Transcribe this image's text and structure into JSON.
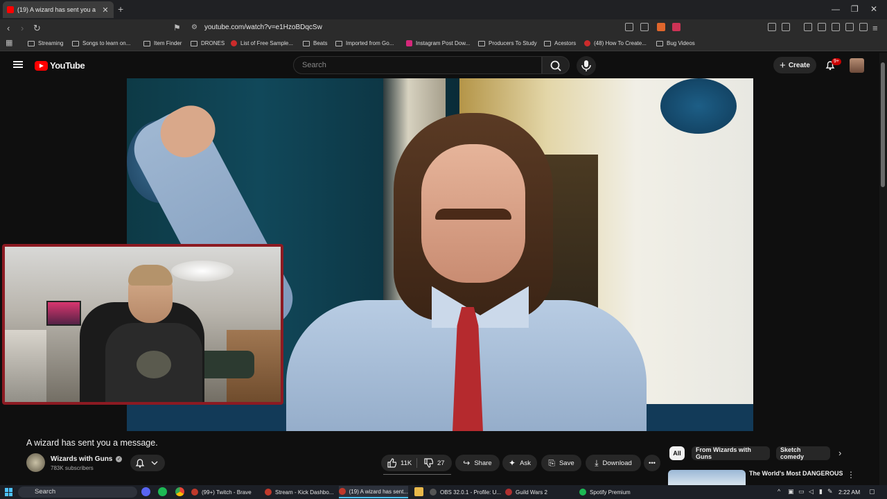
{
  "browser": {
    "active_tab_title": "(19) A wizard has sent you a",
    "url": "youtube.com/watch?v=e1HzoBDqcSw",
    "bookmarks": [
      {
        "label": "Streaming",
        "icon": "folder-icon"
      },
      {
        "label": "Songs to learn on...",
        "icon": "folder-icon"
      },
      {
        "label": "Item Finder",
        "icon": "folder-icon"
      },
      {
        "label": "DRONES",
        "icon": "folder-icon"
      },
      {
        "label": "List of Free Sample...",
        "icon": "site-icon"
      },
      {
        "label": "Beats",
        "icon": "folder-icon"
      },
      {
        "label": "Imported from Go...",
        "icon": "folder-icon"
      },
      {
        "label": "Instagram Post Dow...",
        "icon": "instagram-icon"
      },
      {
        "label": "Producers To Study",
        "icon": "folder-icon"
      },
      {
        "label": "Acestors",
        "icon": "folder-icon"
      },
      {
        "label": "(48) How To Create...",
        "icon": "youtube-icon"
      },
      {
        "label": "Bug Videos",
        "icon": "folder-icon"
      }
    ]
  },
  "youtube": {
    "logo_text": "YouTube",
    "search_placeholder": "Search",
    "create_label": "Create",
    "notifications_badge": "9+",
    "video": {
      "title": "A wizard has sent you a message.",
      "channel": "Wizards with Guns",
      "subscribers": "783K subscribers",
      "likes": "11K",
      "dislikes": "27",
      "actions": {
        "share": "Share",
        "ask": "Ask",
        "save": "Save",
        "download": "Download"
      }
    },
    "chips": [
      "All",
      "From Wizards with Guns",
      "Sketch comedy"
    ],
    "recommendation": {
      "title": "The World's Most DANGEROUS Job"
    }
  },
  "taskbar": {
    "search_placeholder": "Search",
    "items": [
      {
        "label": "(99+) Twitch - Brave",
        "color": "#c0392b"
      },
      {
        "label": "Stream - Kick Dashbo...",
        "color": "#c0392b"
      },
      {
        "label": "(19) A wizard has sent...",
        "color": "#c0392b"
      },
      {
        "label": "OBS 32.0.1 - Profile: U...",
        "color": "#555555"
      },
      {
        "label": "Guild Wars 2",
        "color": "#b03030"
      },
      {
        "label": "Spotify Premium",
        "color": "#1db954"
      }
    ],
    "time": "2:22 AM"
  },
  "colors": {
    "youtube_red": "#ff0000",
    "background": "#0f0f0f",
    "webcam_border": "#8c1a22"
  }
}
